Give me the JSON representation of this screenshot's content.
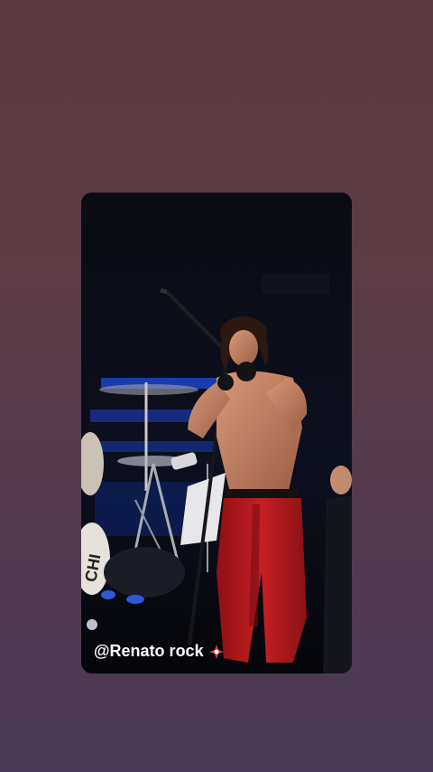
{
  "story": {
    "caption": "@Renato rock",
    "caption_icon": "sparkle-star-icon",
    "media_description_icon": "video-frame"
  },
  "colors": {
    "background_top": "#5a3a40",
    "background_bottom": "#4a3a55",
    "pants_red": "#b2181c",
    "stage_blue": "#1a3fb0"
  }
}
